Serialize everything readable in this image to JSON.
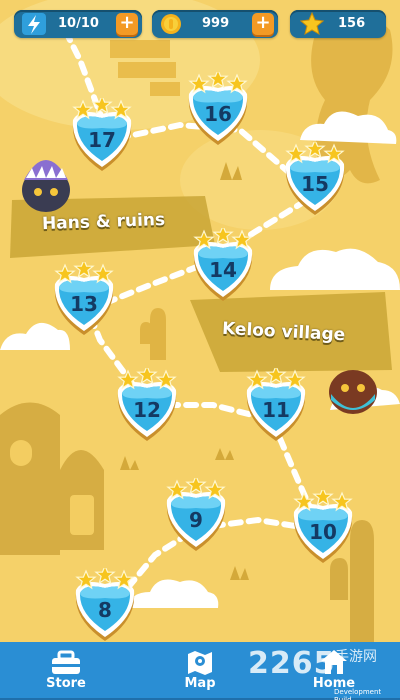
{
  "hud": {
    "energy": {
      "value": "10/10",
      "icon": "lightning-icon",
      "plus": "+"
    },
    "coins": {
      "value": "999",
      "icon": "coin-icon",
      "plus": "+"
    },
    "stars": {
      "value": "156",
      "icon": "star-icon"
    }
  },
  "zones": {
    "hans": "Hans & ruins",
    "keloo": "Keloo village"
  },
  "levels": [
    {
      "number": "8",
      "stars": 3
    },
    {
      "number": "9",
      "stars": 3
    },
    {
      "number": "10",
      "stars": 3
    },
    {
      "number": "11",
      "stars": 3
    },
    {
      "number": "12",
      "stars": 3
    },
    {
      "number": "13",
      "stars": 3
    },
    {
      "number": "14",
      "stars": 3
    },
    {
      "number": "15",
      "stars": 3
    },
    {
      "number": "16",
      "stars": 3
    },
    {
      "number": "17",
      "stars": 3
    }
  ],
  "nav": {
    "store": "Store",
    "map": "Map",
    "home": "Home"
  },
  "watermark": {
    "main": "2265",
    "sub": "手游网",
    "dev": "Development Build"
  },
  "colors": {
    "background": "#f5d169",
    "level_blue": "#35b3e6",
    "star_gold": "#f7c51e",
    "nav_blue": "#2a8ed4",
    "hud_blue": "#1f6f9a"
  }
}
